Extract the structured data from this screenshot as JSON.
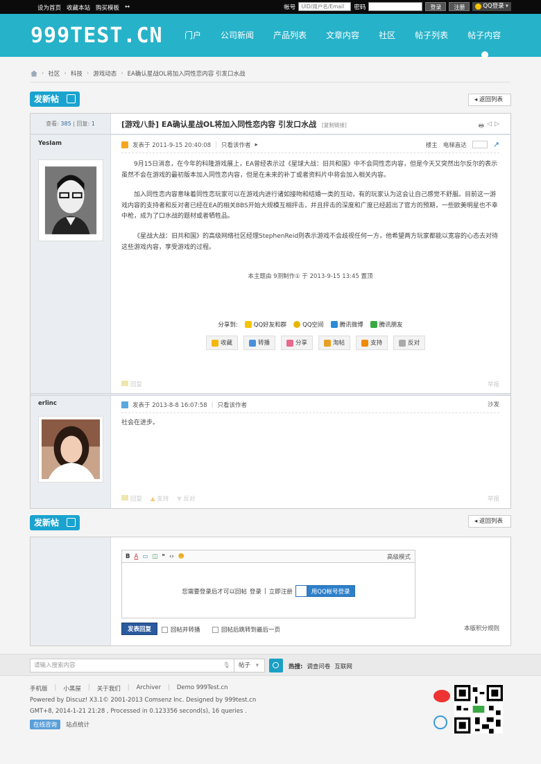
{
  "topbar": {
    "links": [
      "设为首页",
      "收藏本站",
      "购买模板",
      "↔"
    ],
    "account_label": "帐号",
    "account_placeholder": "UID/用户名/Email",
    "password_label": "密码",
    "login_btn": "登录",
    "register_btn": "注册",
    "qq_login": "QQ登录"
  },
  "header": {
    "logo": "999TEST.CN",
    "nav": [
      "门户",
      "公司新闻",
      "产品列表",
      "文章内容",
      "社区",
      "帖子列表",
      "帖子内容"
    ]
  },
  "breadcrumb": [
    "社区",
    "科技",
    "游戏动态",
    "EA确认星战OL将加入同性恋内容 引发口水战"
  ],
  "new_post": "发新帖",
  "back_to_list": "返回列表",
  "thread": {
    "views_label": "查看:",
    "views": "385",
    "replies_label": "回复:",
    "replies": "1",
    "title": "[游戏八卦] EA确认星战OL将加入同性恋内容 引发口水战",
    "copy_link": "[复制链接]",
    "tools": [
      "🖶",
      "◁",
      "▷"
    ]
  },
  "posts": [
    {
      "author": "YesIam",
      "posted": "发表于 2011-9-15 20:40:08",
      "only_author": "只看该作者",
      "floor": "楼主",
      "jump": "电梯直达",
      "paragraphs": [
        "9月15日消息，在今年的科隆游戏展上，EA曾经表示过《星球大战：旧共和国》中不会同性恋内容，但是今天又突然出尔反尔的表示虽然不会在游戏的最初版本加入同性恋内容，但是在未来的补丁或者资料片中将会加入相关内容。",
        "加入同性恋内容意味着同性恋玩家可以在游戏内进行诸如接吻和结婚一类的互动，有的玩家认为这会让自己感觉不舒服。目前这一游戏内容的支持者和反对者已经在EA的相关BBS开始大规模互相抨击，并且抨击的深度和广度已经超出了官方的预期，一些欧美明星也不幸中枪，成为了口水战的题材或者牺牲品。",
        "《星战大战：旧共和国》的高级网络社区经理StephenReid则表示游戏不会歧视任何一方，他希望两方玩家都能以宽容的心态去对待这些游戏内容，享受游戏的过程。"
      ],
      "edited": "本主题由 9测制作① 于 2013-9-15 13:45 置顶",
      "share_label": "分享到:",
      "share": [
        "QQ好友和群",
        "QQ空间",
        "腾讯微博",
        "腾讯朋友"
      ],
      "actions": [
        "收藏",
        "转播",
        "分享",
        "淘帖",
        "支持",
        "反对"
      ],
      "foot": [
        "回复"
      ],
      "report": "举报"
    },
    {
      "author": "erlinc",
      "posted": "发表于 2013-8-8 16:07:58",
      "only_author": "只看该作者",
      "floor": "沙发",
      "text": "社会在进步。",
      "foot": [
        "回复",
        "支持",
        "反对"
      ],
      "report": "举报"
    }
  ],
  "reply": {
    "toolbar": [
      "B",
      "A",
      "▭",
      "◫",
      "❝",
      "‹›",
      "☻"
    ],
    "advanced": "高级模式",
    "need_login": "您需要登录后才可以回帖",
    "login": "登录",
    "register": "立即注册",
    "qq_account_login": "用QQ帐号登录",
    "submit": "发表回复",
    "check1": "回帖并转播",
    "check2": "回帖后跳转到最后一页",
    "rules": "本版积分规则"
  },
  "search": {
    "placeholder": "请输入搜索内容",
    "type": "帖子",
    "hot_label": "热搜:",
    "hot": [
      "调查问卷",
      "互联网"
    ]
  },
  "footer": {
    "links": [
      "手机版",
      "小黑屋",
      "关于我们",
      "Archiver",
      "Demo 999Test.cn"
    ],
    "line1": "Powered by Discuz! X3.1© 2001-2013 Comsenz Inc. Designed by 999test.cn",
    "line2": "GMT+8, 2014-1-21 21:28 , Processed in 0.123356 second(s), 16 queries .",
    "online": "在线咨询",
    "stats": "站点统计"
  },
  "colors": {
    "header": "#26b2c9",
    "accent": "#1aa3cf",
    "topbar": "#0b0b0b"
  }
}
